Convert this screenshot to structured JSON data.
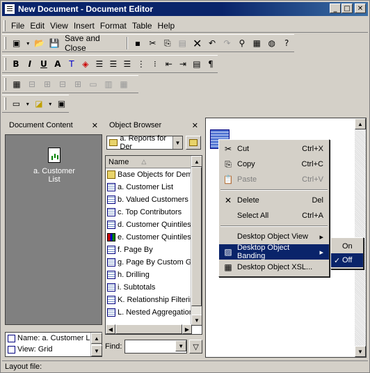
{
  "window": {
    "title": "New Document - Document Editor",
    "min": "_",
    "max": "□",
    "close": "✕"
  },
  "menubar": [
    "File",
    "Edit",
    "View",
    "Insert",
    "Format",
    "Table",
    "Help"
  ],
  "toolbar1": {
    "save_close": "Save and Close"
  },
  "panels": {
    "doc_content": {
      "title": "Document Content",
      "item": "a. Customer List",
      "footer_name": "Name: a. Customer List",
      "footer_view": "View: Grid"
    },
    "object_browser": {
      "title": "Object Browser",
      "folder": "a. Reports for Der",
      "column": "Name",
      "items": [
        {
          "label": "Base Objects for Demo",
          "icon": "folder"
        },
        {
          "label": "a. Customer List",
          "icon": "grid"
        },
        {
          "label": "b. Valued Customers",
          "icon": "grid"
        },
        {
          "label": "c. Top Contributors",
          "icon": "grid"
        },
        {
          "label": "d. Customer Quintiles",
          "icon": "grid"
        },
        {
          "label": "e. Customer Quintiles Char",
          "icon": "chart"
        },
        {
          "label": "f. Page By",
          "icon": "grid"
        },
        {
          "label": "g. Page By Custom Group",
          "icon": "grid"
        },
        {
          "label": "h. Drilling",
          "icon": "grid"
        },
        {
          "label": "i. Subtotals",
          "icon": "grid"
        },
        {
          "label": "K. Relationship Filtering",
          "icon": "grid"
        },
        {
          "label": "L. Nested Aggregation",
          "icon": "grid"
        }
      ],
      "find_label": "Find:"
    }
  },
  "context_menu": {
    "items": [
      {
        "icon": "✂",
        "label": "Cut",
        "accel": "Ctrl+X",
        "disabled": false
      },
      {
        "icon": "⎘",
        "label": "Copy",
        "accel": "Ctrl+C",
        "disabled": false
      },
      {
        "icon": "📋",
        "label": "Paste",
        "accel": "Ctrl+V",
        "disabled": true
      },
      {
        "sep": true
      },
      {
        "icon": "✕",
        "label": "Delete",
        "accel": "Del",
        "disabled": false
      },
      {
        "icon": "",
        "label": "Select All",
        "accel": "Ctrl+A",
        "disabled": false
      },
      {
        "sep": true
      },
      {
        "icon": "",
        "label": "Desktop Object View",
        "accel": "▸",
        "disabled": false
      },
      {
        "icon": "▨",
        "label": "Desktop Object Banding",
        "accel": "▸",
        "disabled": false,
        "selected": true
      },
      {
        "icon": "▦",
        "label": "Desktop Object XSL...",
        "accel": "",
        "disabled": false
      }
    ],
    "submenu": [
      {
        "label": "On",
        "checked": false
      },
      {
        "label": "Off",
        "checked": true,
        "selected": true
      }
    ]
  },
  "statusbar": "Layout file:"
}
